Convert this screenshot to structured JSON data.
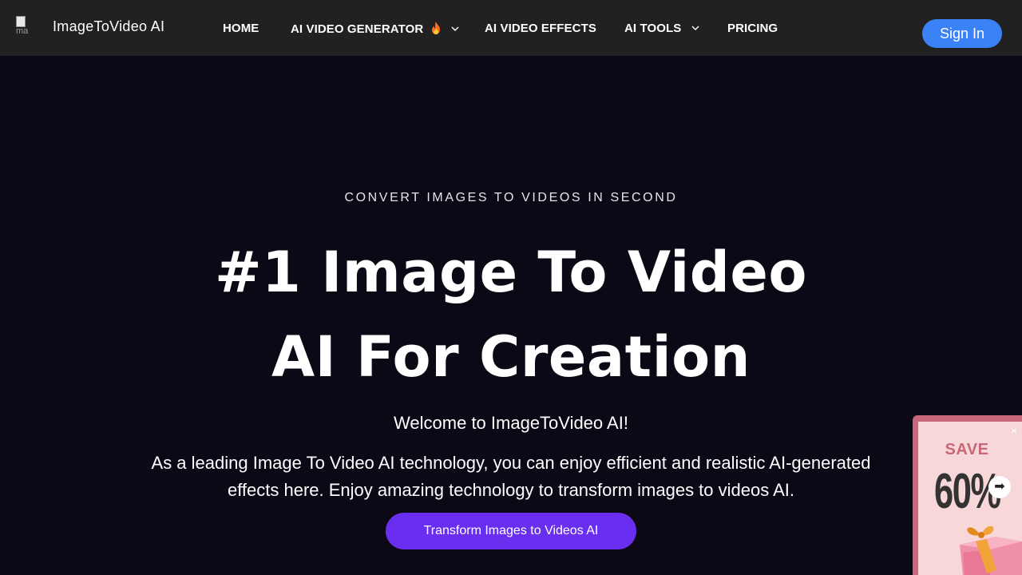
{
  "header": {
    "logo_alt": "ma",
    "brand": "ImageToVideo AI",
    "nav": [
      {
        "label": "HOME"
      },
      {
        "label": "AI VIDEO GENERATOR"
      },
      {
        "label": "AI VIDEO EFFECTS"
      },
      {
        "label": "AI TOOLS"
      },
      {
        "label": "PRICING"
      }
    ],
    "signin_label": "Sign In"
  },
  "hero": {
    "eyebrow": "CONVERT IMAGES TO VIDEOS IN SECOND",
    "title_line1": "#1 Image To Video",
    "title_line2": "AI For Creation",
    "welcome": "Welcome to ImageToVideo AI!",
    "description": "As a leading Image To Video AI technology, you can enjoy efficient and realistic AI-generated effects here. Enjoy amazing technology to transform images to videos AI.",
    "cta_label": "Transform Images to Videos AI"
  },
  "promo": {
    "save_label": "SAVE",
    "discount": "60%",
    "close_glyph": "×",
    "arrow_glyph": "➡"
  },
  "colors": {
    "background": "#0c0815",
    "navbar": "#212121",
    "signin": "#3b82f6",
    "cta": "#6a2ef0",
    "promo_frame": "#c9677a",
    "promo_bg": "#f7d7d8"
  },
  "icons": {
    "flame": "flame-icon",
    "chevron": "chevron-down-icon"
  }
}
